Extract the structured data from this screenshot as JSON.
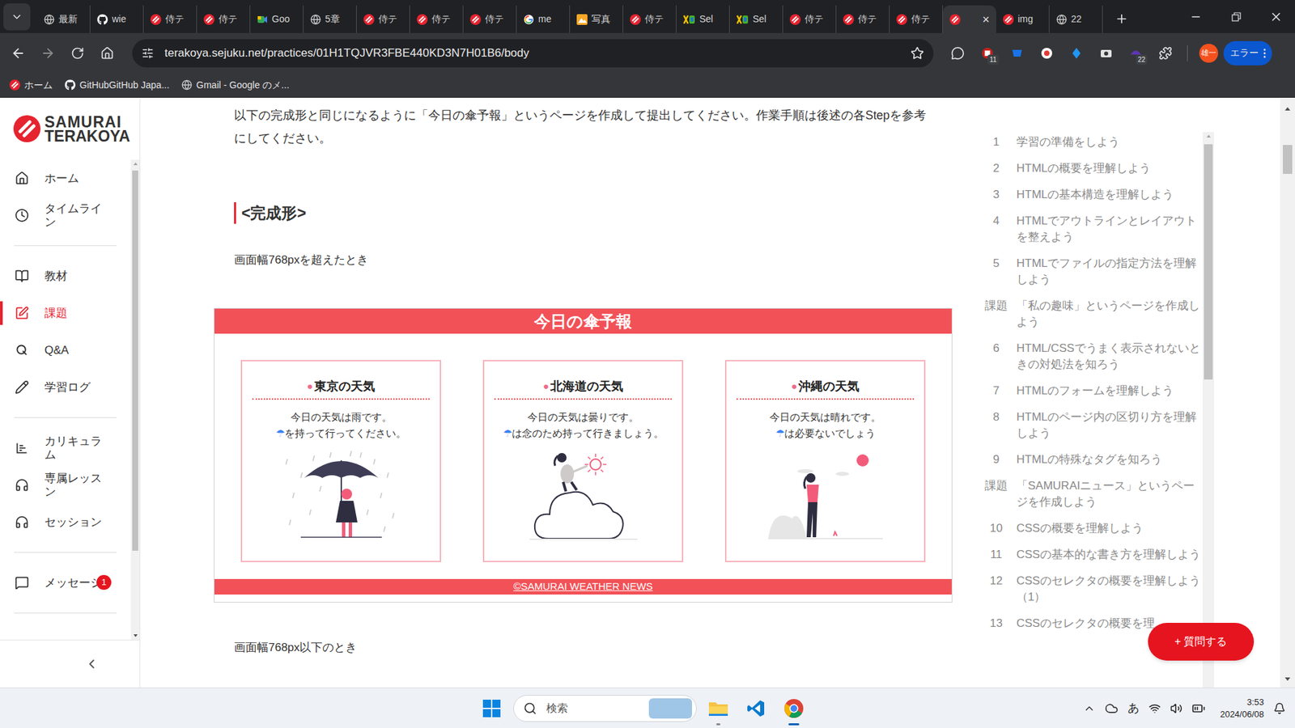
{
  "browser": {
    "tabs": [
      {
        "label": "最新",
        "kind": "globe",
        "selected": false
      },
      {
        "label": "wie",
        "kind": "github",
        "selected": false
      },
      {
        "label": "侍テ",
        "kind": "samurai",
        "selected": false
      },
      {
        "label": "侍テ",
        "kind": "samurai",
        "selected": false
      },
      {
        "label": "Goo",
        "kind": "meet",
        "selected": false
      },
      {
        "label": "5章",
        "kind": "globe",
        "selected": false
      },
      {
        "label": "侍テ",
        "kind": "samurai",
        "selected": false
      },
      {
        "label": "侍テ",
        "kind": "samurai",
        "selected": false
      },
      {
        "label": "侍テ",
        "kind": "samurai",
        "selected": false
      },
      {
        "label": "me",
        "kind": "google",
        "selected": false
      },
      {
        "label": "写真",
        "kind": "photo",
        "selected": false
      },
      {
        "label": "侍テ",
        "kind": "samurai",
        "selected": false
      },
      {
        "label": "Sel",
        "kind": "selenium",
        "selected": false
      },
      {
        "label": "Sel",
        "kind": "selenium",
        "selected": false
      },
      {
        "label": "侍テ",
        "kind": "samurai",
        "selected": false
      },
      {
        "label": "侍テ",
        "kind": "samurai",
        "selected": false
      },
      {
        "label": "侍テ",
        "kind": "samurai",
        "selected": false
      },
      {
        "label": "",
        "kind": "samurai",
        "selected": true,
        "close": "×"
      },
      {
        "label": "img",
        "kind": "samurai",
        "selected": false
      },
      {
        "label": "22",
        "kind": "globe",
        "selected": false
      }
    ],
    "url": "terakoya.sejuku.net/practices/01H1TQJVR3FBE440KD3N7H01B6/body",
    "extensions": [
      {
        "kind": "chat"
      },
      {
        "kind": "red",
        "badge": "11"
      },
      {
        "kind": "blue"
      },
      {
        "kind": "record"
      },
      {
        "kind": "drop"
      },
      {
        "kind": "camera"
      },
      {
        "kind": "purple",
        "badge": "22"
      },
      {
        "kind": "puzzle"
      }
    ],
    "profile": "雄一",
    "status_button": "エラー",
    "bookmarks": [
      {
        "label": "ホーム",
        "kind": "samurai"
      },
      {
        "label": "GitHubGitHub Japa...",
        "kind": "github"
      },
      {
        "label": "Gmail - Google のメ...",
        "kind": "globe"
      }
    ]
  },
  "sidebar": {
    "logo": [
      "SAMURAI",
      "TERAKOYA"
    ],
    "groups": [
      [
        {
          "label": "ホーム",
          "kind": "home",
          "selected": false
        },
        {
          "label": "タイムライン",
          "kind": "clock",
          "selected": false
        }
      ],
      [
        {
          "label": "教材",
          "kind": "book",
          "selected": false
        },
        {
          "label": "課題",
          "kind": "assignment",
          "selected": true
        },
        {
          "label": "Q&A",
          "kind": "qa",
          "selected": false
        },
        {
          "label": "学習ログ",
          "kind": "log",
          "selected": false
        }
      ],
      [
        {
          "label": "カリキュラム",
          "kind": "curriculum",
          "selected": false
        },
        {
          "label": "専属レッスン",
          "kind": "lesson",
          "selected": false
        },
        {
          "label": "セッション",
          "kind": "session",
          "selected": false
        }
      ],
      [
        {
          "label": "メッセージ",
          "kind": "message",
          "selected": false,
          "badge": "1"
        }
      ]
    ]
  },
  "content": {
    "intro": "以下の完成形と同じになるように「今日の傘予報」というページを作成して提出してください。作業手順は後述の各Stepを参考にしてください。",
    "heading": "<完成形>",
    "wide_label": "画面幅768pxを超えたとき",
    "preview": {
      "title": "今日の傘予報",
      "cards": [
        {
          "title": "東京の天気",
          "bullet": "●",
          "line1": "今日の天気は雨です。",
          "icon": "☂",
          "line2": "を持って行ってください。",
          "kind": "rain"
        },
        {
          "title": "北海道の天気",
          "bullet": "●",
          "line1": "今日の天気は曇りです。",
          "icon": "☂",
          "line2": "は念のため持って行きましょう。",
          "kind": "cloud"
        },
        {
          "title": "沖縄の天気",
          "bullet": "●",
          "line1": "今日の天気は晴れです。",
          "icon": "☂",
          "line2": "は必要ないでしょう",
          "kind": "sun"
        }
      ],
      "footer": "©SAMURAI WEATHER NEWS"
    },
    "narrow_label": "画面幅768px以下のとき"
  },
  "toc": [
    {
      "num": "1",
      "text": "学習の準備をしよう"
    },
    {
      "num": "2",
      "text": "HTMLの概要を理解しよう"
    },
    {
      "num": "3",
      "text": "HTMLの基本構造を理解しよう"
    },
    {
      "num": "4",
      "text": "HTMLでアウトラインとレイアウトを整えよう"
    },
    {
      "num": "5",
      "text": "HTMLでファイルの指定方法を理解しよう"
    },
    {
      "num": "課題",
      "text": "「私の趣味」というページを作成しよう"
    },
    {
      "num": "6",
      "text": "HTML/CSSでうまく表示されないときの対処法を知ろう"
    },
    {
      "num": "7",
      "text": "HTMLのフォームを理解しよう"
    },
    {
      "num": "8",
      "text": "HTMLのページ内の区切り方を理解しよう"
    },
    {
      "num": "9",
      "text": "HTMLの特殊なタグを知ろう"
    },
    {
      "num": "課題",
      "text": "「SAMURAIニュース」というページを作成しよう"
    },
    {
      "num": "10",
      "text": "CSSの概要を理解しよう"
    },
    {
      "num": "11",
      "text": "CSSの基本的な書き方を理解しよう"
    },
    {
      "num": "12",
      "text": "CSSのセレクタの概要を理解しよう（1）"
    },
    {
      "num": "13",
      "text": "CSSのセレクタの概要を理"
    }
  ],
  "ask_button": "+ 質問する",
  "taskbar": {
    "search": "検索",
    "apps": [
      {
        "kind": "explorer",
        "open": true,
        "active": false
      },
      {
        "kind": "vscode",
        "open": false,
        "active": false
      },
      {
        "kind": "chrome",
        "open": true,
        "active": true
      }
    ],
    "ime": "あ",
    "time": "3:53",
    "date": "2024/06/08"
  }
}
